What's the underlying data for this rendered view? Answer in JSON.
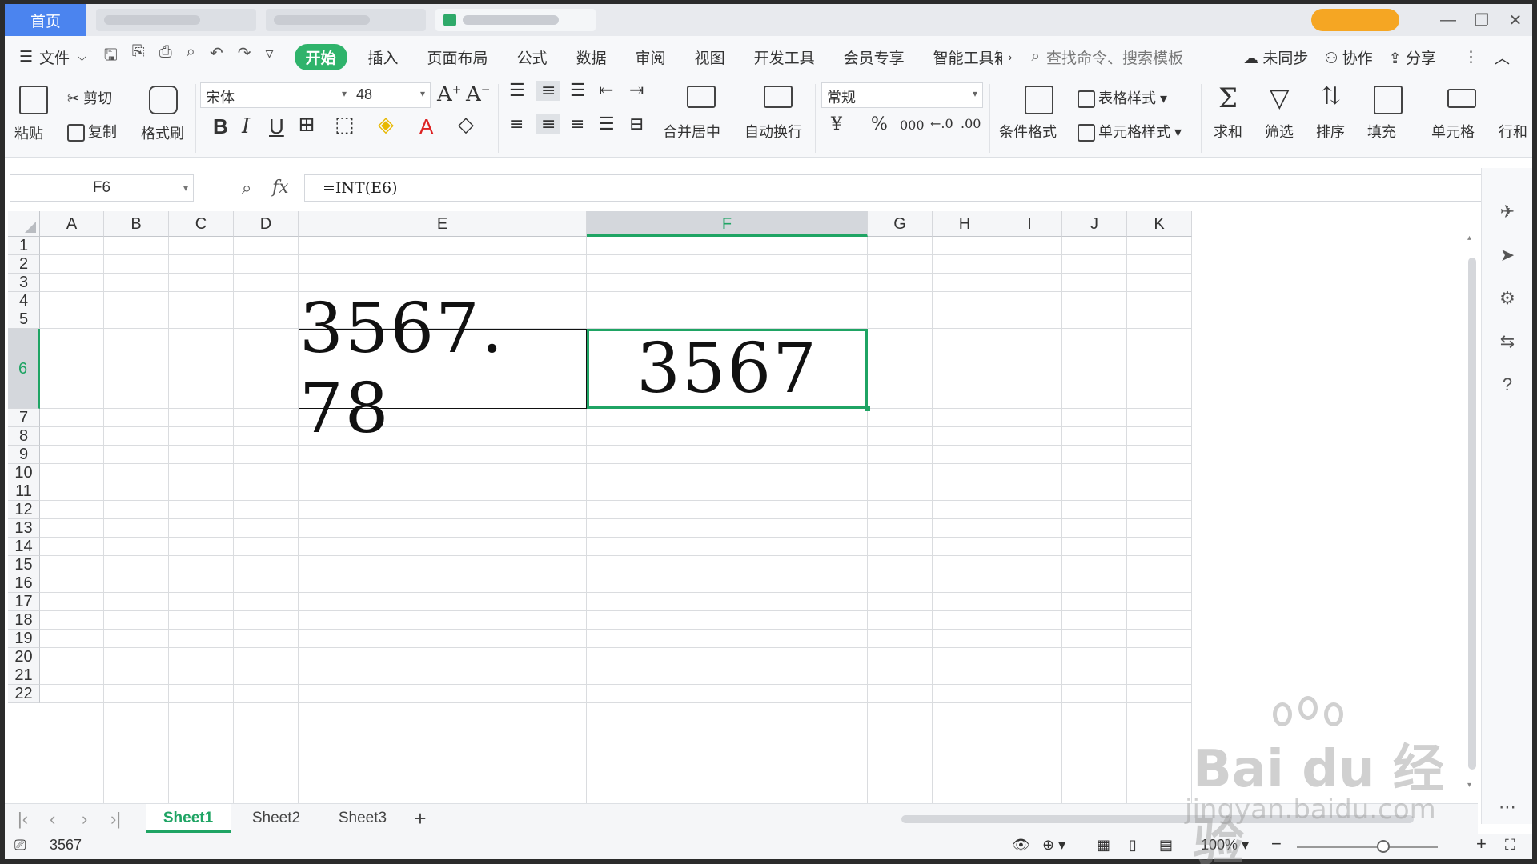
{
  "titlebar": {
    "home_tab": "首页"
  },
  "menubar": {
    "file_label": "文件",
    "items": [
      "开始",
      "插入",
      "页面布局",
      "公式",
      "数据",
      "审阅",
      "视图",
      "开发工具",
      "会员专享",
      "智能工具箱"
    ],
    "active_item": "开始",
    "search_placeholder": "查找命令、搜索模板",
    "sync_label": "未同步",
    "collab_label": "协作",
    "share_label": "分享"
  },
  "ribbon": {
    "paste": "粘贴",
    "cut": "剪切",
    "copy": "复制",
    "format_painter": "格式刷",
    "font_name": "宋体",
    "font_size": "48",
    "merge_center": "合并居中",
    "wrap_text": "自动换行",
    "number_format": "常规",
    "conditional_format": "条件格式",
    "table_style": "表格样式",
    "cell_style": "单元格样式",
    "sum": "求和",
    "filter": "筛选",
    "sort": "排序",
    "fill": "填充",
    "cell": "单元格",
    "row_col": "行和"
  },
  "formula_bar": {
    "name_box": "F6",
    "formula": "=INT(E6)"
  },
  "grid": {
    "columns": [
      "A",
      "B",
      "C",
      "D",
      "E",
      "F",
      "G",
      "H",
      "I",
      "J",
      "K"
    ],
    "selected_column": "F",
    "rows": [
      "1",
      "2",
      "3",
      "4",
      "5",
      "6",
      "7",
      "8",
      "9",
      "10",
      "11",
      "12",
      "13",
      "14",
      "15",
      "16",
      "17",
      "18",
      "19",
      "20",
      "21",
      "22"
    ],
    "selected_row": "6",
    "cells": {
      "E6": "3567. 78",
      "F6": "3567"
    }
  },
  "sheets": {
    "tabs": [
      "Sheet1",
      "Sheet2",
      "Sheet3"
    ],
    "active": "Sheet1",
    "add_label": "+"
  },
  "statusbar": {
    "value": "3567",
    "zoom": "100%"
  },
  "watermark": {
    "brand": "Bai du 经验",
    "url": "jingyan.baidu.com"
  },
  "colors": {
    "accent_green": "#1fa464",
    "home_tab_blue": "#4b84ef"
  }
}
